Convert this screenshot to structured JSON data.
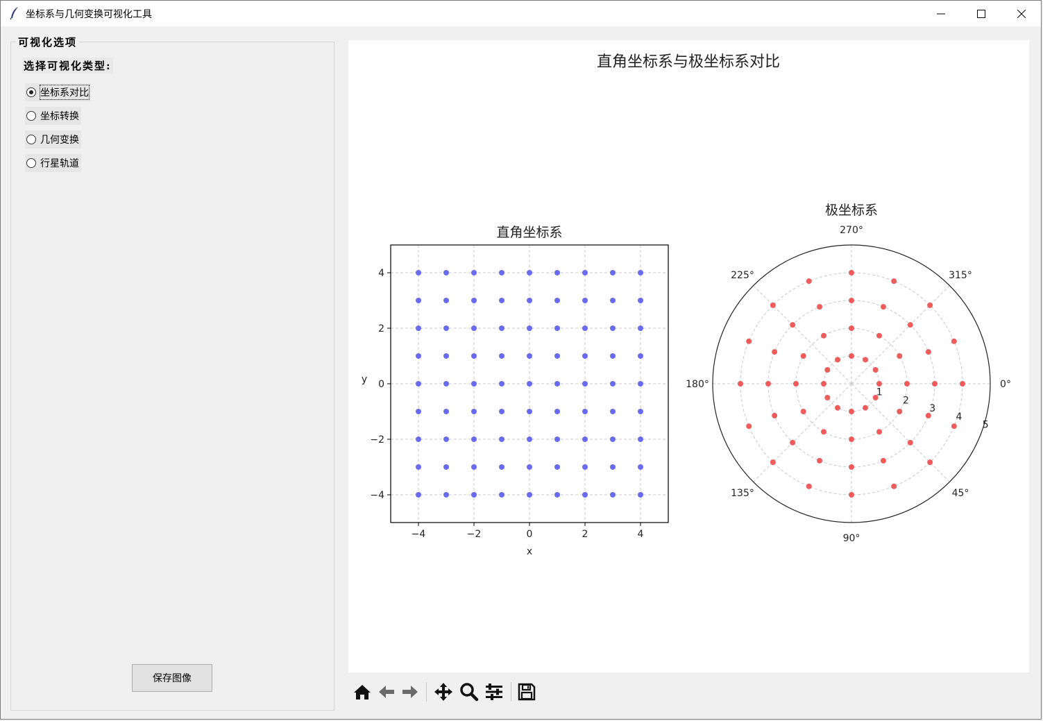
{
  "window": {
    "title": "坐标系与几何变换可视化工具",
    "minimize_icon": "minimize-icon",
    "maximize_icon": "maximize-icon",
    "close_icon": "close-icon"
  },
  "sidebar": {
    "frame_title": "可视化选项",
    "select_label": "选择可视化类型:",
    "options": [
      {
        "label": "坐标系对比",
        "selected": true
      },
      {
        "label": "坐标转换",
        "selected": false
      },
      {
        "label": "几何变换",
        "selected": false
      },
      {
        "label": "行星轨道",
        "selected": false
      }
    ],
    "save_button": "保存图像"
  },
  "toolbar": {
    "icons": [
      "home-icon",
      "back-icon",
      "forward-icon",
      "pan-icon",
      "zoom-icon",
      "configure-subplots-icon",
      "save-icon"
    ]
  },
  "colors": {
    "cartesian_points": "#6b6bef",
    "polar_points": "#ef5c5c",
    "grid": "#c8c8c8"
  },
  "chart_data": [
    {
      "type": "scatter",
      "title": "直角坐标系",
      "suptitle": "直角坐标系与极坐标系对比",
      "xlabel": "x",
      "ylabel": "y",
      "xlim": [
        -5,
        5
      ],
      "ylim": [
        -5,
        5
      ],
      "xticks": [
        "−4",
        "−2",
        "0",
        "2",
        "4"
      ],
      "yticks": [
        "4",
        "2",
        "0",
        "−2",
        "−4"
      ],
      "grid": true,
      "x_values": [
        -4,
        -3,
        -2,
        -1,
        0,
        1,
        2,
        3,
        4
      ],
      "y_values": [
        -4,
        -3,
        -2,
        -1,
        0,
        1,
        2,
        3,
        4
      ]
    },
    {
      "type": "scatter",
      "projection": "polar",
      "title": "极坐标系",
      "rmax": 5,
      "theta_direction": "clockwise",
      "rticks": [
        "1",
        "2",
        "3",
        "4",
        "5"
      ],
      "thetaticks": [
        "0°",
        "45°",
        "90°",
        "135°",
        "180°",
        "225°",
        "270°",
        "315°"
      ],
      "grid": true,
      "radii": [
        1,
        2,
        3,
        4
      ],
      "angles_per_radius": [
        12,
        12,
        16,
        16
      ]
    }
  ]
}
